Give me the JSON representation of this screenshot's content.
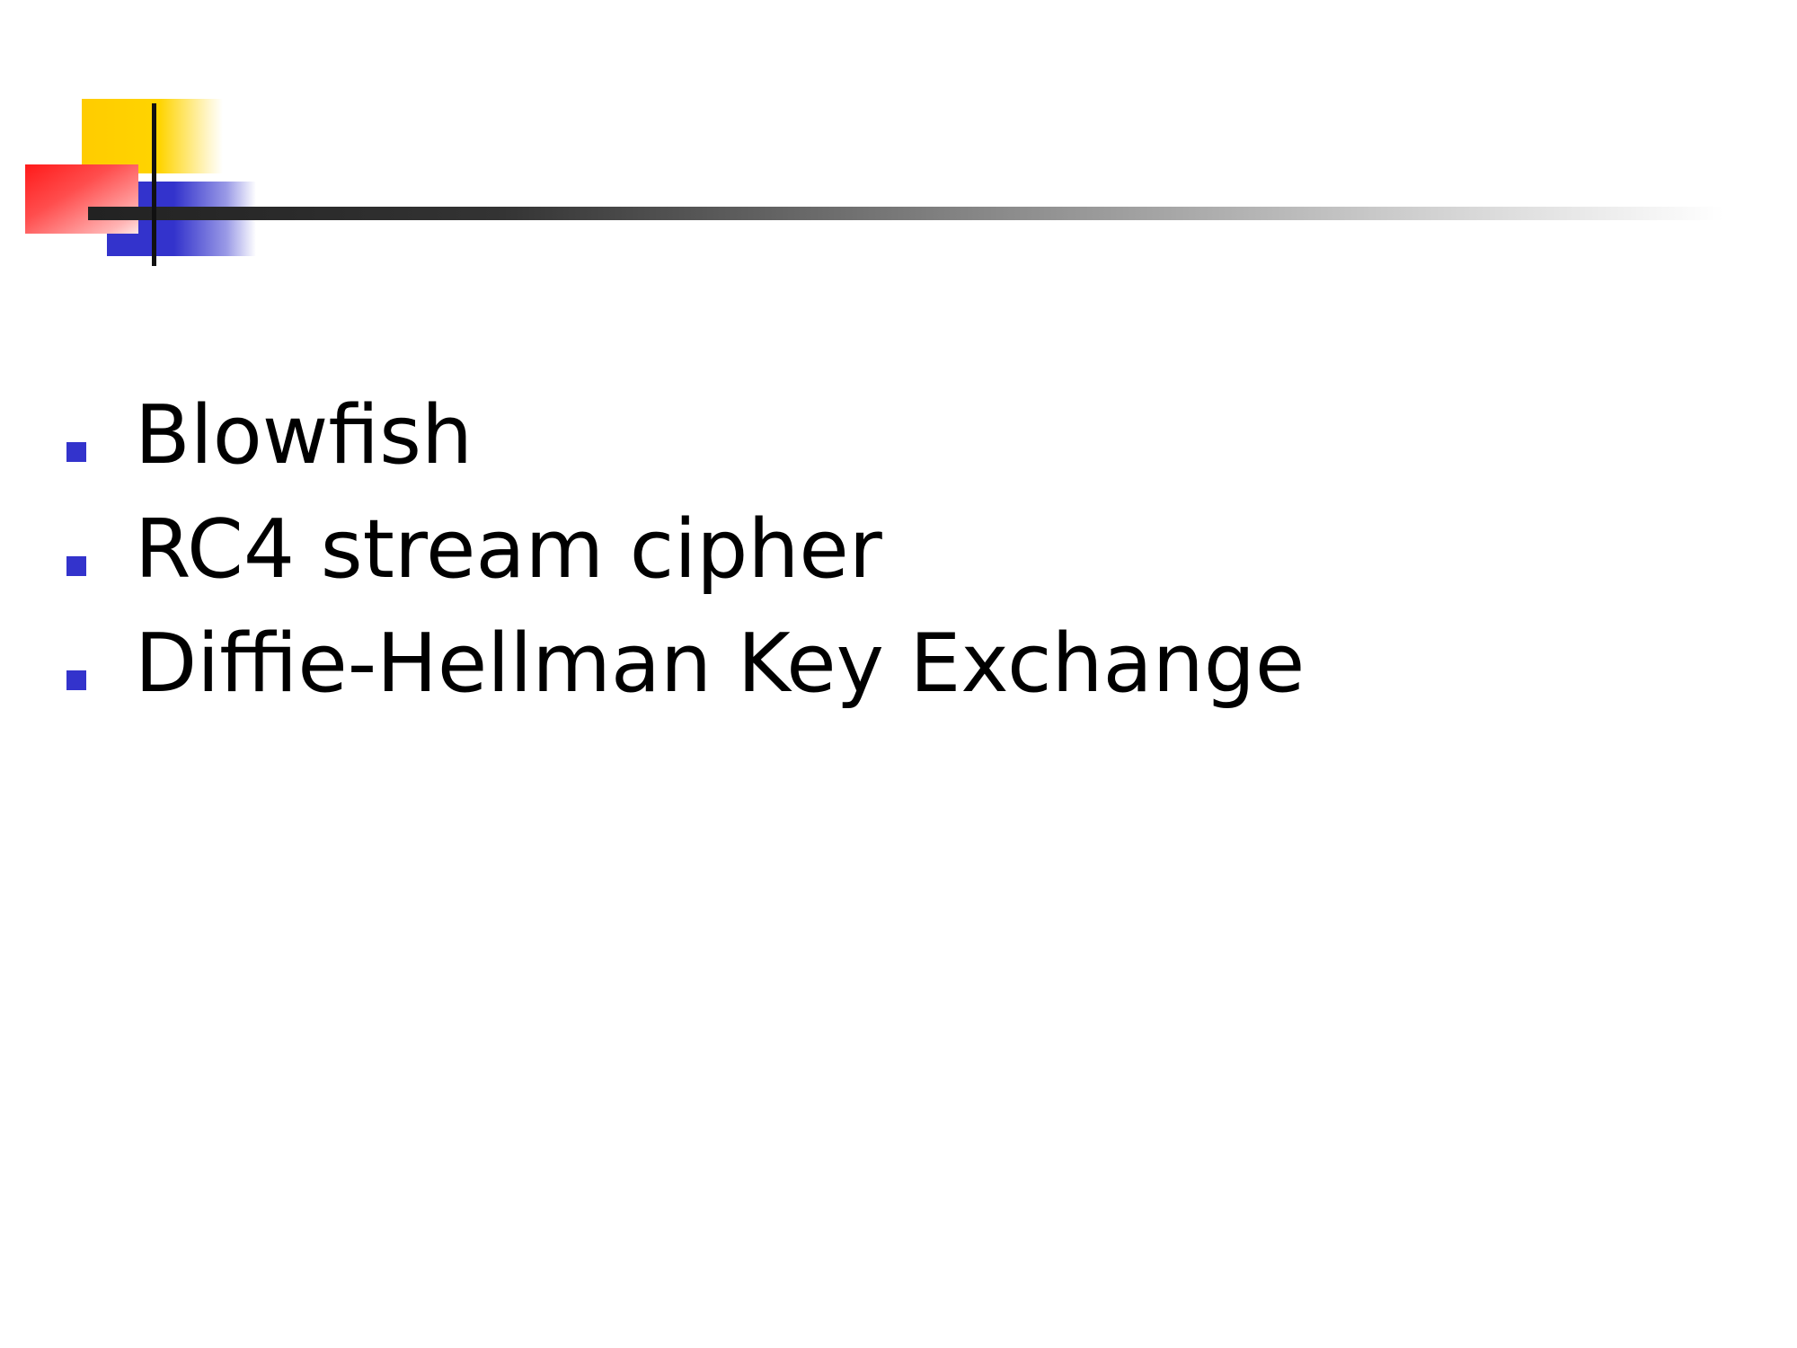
{
  "slide": {
    "bullets": [
      {
        "text": "Blowfish",
        "marker_color": "#3333cc"
      },
      {
        "text": "RC4 stream cipher",
        "marker_color": "#3333cc"
      },
      {
        "text": "Diffie-Hellman Key Exchange",
        "marker_color": "#3333cc"
      }
    ]
  },
  "colors": {
    "accent_yellow": "#ffcc00",
    "accent_red": "#ff1a1a",
    "accent_blue": "#3333cc",
    "rule_dark": "#222222",
    "text": "#000000",
    "background": "#ffffff"
  }
}
